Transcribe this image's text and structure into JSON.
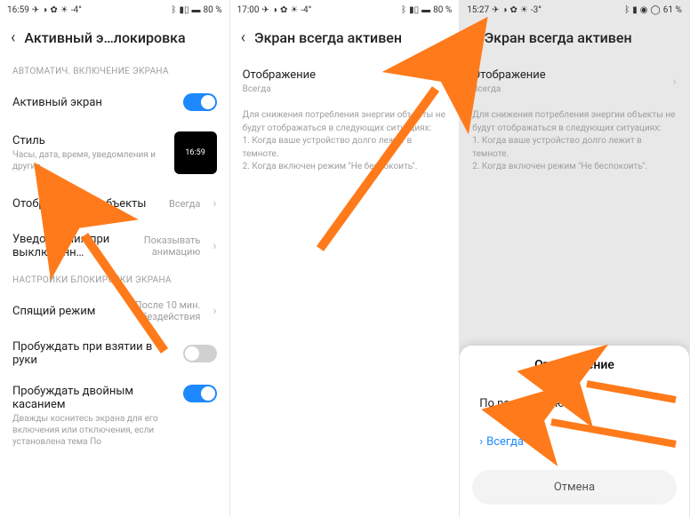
{
  "status": {
    "time1": "16:59",
    "time2": "17:00",
    "time3": "15:27",
    "temp1": "-4°",
    "temp2": "-4°",
    "temp3": "-3°",
    "battery1": "80 %",
    "battery2": "80 %",
    "battery3": "61 %"
  },
  "panel1": {
    "title": "Активный э…локировка",
    "section1": "АВТОМАТИЧ. ВКЛЮЧЕНИЕ ЭКРАНА",
    "row_active": "Активный экран",
    "row_style": "Стиль",
    "row_style_sub": "Часы, дата, время, уведомления и другие",
    "style_clock": "16:59",
    "row_objects": "Отображаемые объекты",
    "row_objects_value": "Всегда",
    "row_notif": "Уведомления при выключенн…",
    "row_notif_value": "Показывать анимацию",
    "section2": "НАСТРОЙКИ БЛОКИРОВКИ ЭКРАНА",
    "row_sleep": "Спящий режим",
    "row_sleep_value": "После 10 мин. бездействия",
    "row_raise": "Пробуждать при взятии в руки",
    "row_doubletap": "Пробуждать двойным касанием",
    "row_doubletap_sub": "Дважды коснитесь экрана для его включения или отключения, если установлена тема По"
  },
  "panel2": {
    "title": "Экран всегда активен",
    "row_display": "Отображение",
    "row_display_value": "Всегда",
    "help": "Для снижения потребления энергии объекты не будут отображаться в следующих ситуациях:\n1. Когда ваше устройство долго лежит в темноте.\n2. Когда включен режим \"Не беспокоить\"."
  },
  "panel3": {
    "title": "Экран всегда активен",
    "row_display": "Отображение",
    "row_display_value": "Всегда",
    "help": "Для снижения потребления энергии объекты не будут отображаться в следующих ситуациях:\n1. Когда ваше устройство долго лежит в темноте.\n2. Когда включен режим \"Не беспокоить\".",
    "sheet_title": "Отображение",
    "opt_schedule": "По расписанию",
    "opt_always": "Всегда",
    "cancel": "Отмена"
  }
}
